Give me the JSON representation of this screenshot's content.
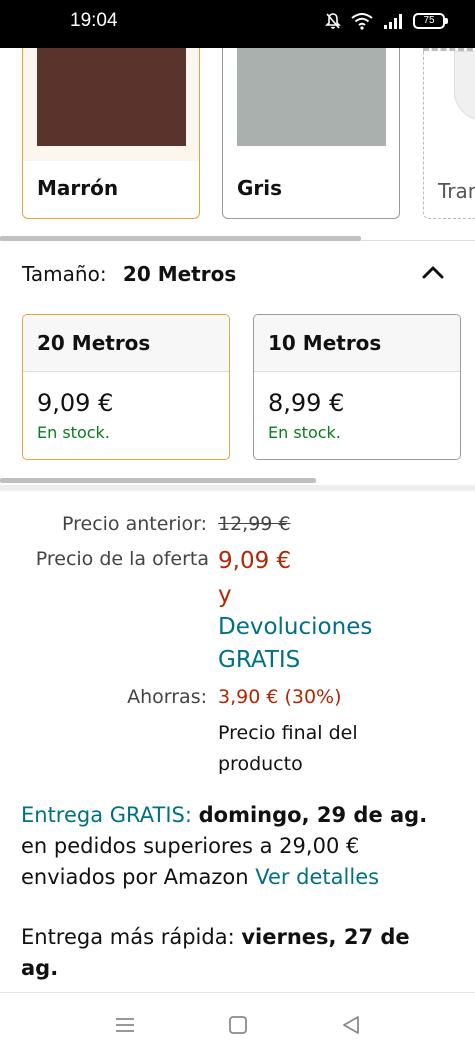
{
  "status_bar": {
    "time": "19:04",
    "battery": "75",
    "icons": [
      "bell-mute-icon",
      "wifi-icon",
      "signal-icon",
      "battery-icon"
    ]
  },
  "colors": {
    "options": [
      {
        "label": "Marrón",
        "swatch": "#5a342c",
        "selected": true
      },
      {
        "label": "Gris",
        "swatch": "#a9b0ae",
        "selected": false
      },
      {
        "label": "Tran",
        "swatch": "#eeeeee",
        "selected": false
      }
    ]
  },
  "size": {
    "label": "Tamaño:",
    "selected_value": "20 Metros",
    "options": [
      {
        "name": "20 Metros",
        "price": "9,09 €",
        "stock": "En stock.",
        "selected": true
      },
      {
        "name": "10 Metros",
        "price": "8,99 €",
        "stock": "En stock.",
        "selected": false
      }
    ]
  },
  "pricing": {
    "previous_label": "Precio anterior:",
    "previous_value": "12,99 €",
    "offer_label": "Precio de la oferta",
    "offer_value": "9,09 €",
    "offer_connector": "y",
    "returns_line1": "Devoluciones",
    "returns_line2": "GRATIS",
    "savings_label": "Ahorras:",
    "savings_value": "3,90 € (30%)",
    "final_line1": "Precio final del",
    "final_line2": "producto"
  },
  "delivery": {
    "free_label": "Entrega GRATIS:",
    "free_date": "domingo, 29 de ag.",
    "line2": "en pedidos superiores a 29,00 €",
    "line3": "enviados por Amazon",
    "details_link": "Ver detalles",
    "fast_label": "Entrega más rápida:",
    "fast_date_1": "viernes, 27 de",
    "fast_date_2": "ag."
  },
  "colors_theme": {
    "accent_selected": "#e7a33d",
    "price_red": "#b12704",
    "link_teal": "#007185",
    "stock_green": "#0a7d1a"
  },
  "nav_bar": {
    "icons": [
      "menu-icon",
      "home-square-icon",
      "back-triangle-icon"
    ]
  }
}
